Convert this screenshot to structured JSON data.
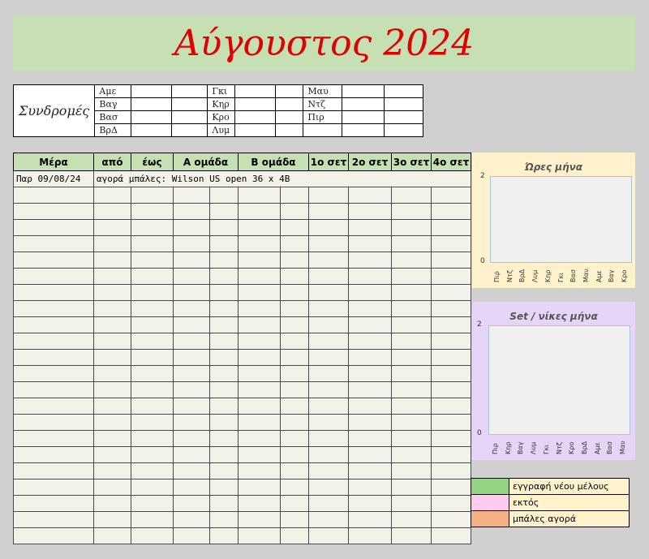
{
  "title": "Αύγουστος 2024",
  "subscriptions": {
    "label": "Συνδρομές",
    "rows": [
      [
        "Αμε",
        "Γκι",
        "Μαυ"
      ],
      [
        "Βαγ",
        "Κηρ",
        "Ντζ"
      ],
      [
        "Βασ",
        "Κρο",
        "Πιρ"
      ],
      [
        "ΒρΔ",
        "Λυμ",
        ""
      ]
    ]
  },
  "schedule": {
    "headers": [
      "Μέρα",
      "από",
      "έως",
      "Α ομάδα",
      "Β ομάδα",
      "1ο σετ",
      "2ο σετ",
      "3ο σετ",
      "4ο σετ"
    ],
    "entry": {
      "day": "Παρ 09/08/24",
      "note": "αγορά μπάλες: Wilson US open 36 x 4B"
    }
  },
  "charts": {
    "hours": {
      "title": "Ώρες μήνα",
      "ymax": "2",
      "ymin": "0",
      "labels": [
        "Πιρ",
        "Ντζ",
        "ΒρΔ",
        "Λυμ",
        "Κηρ",
        "Γκι",
        "Βασ",
        "Μαυ",
        "Αμε",
        "Βαγ",
        "Κρο"
      ]
    },
    "sets": {
      "title": "Set / νίκες μήνα",
      "ymax": "2",
      "ymin": "0",
      "labels": [
        "Πιρ",
        "Κηρ",
        "Βαγ",
        "Λυμ",
        "Γκι",
        "Ντζ",
        "Κρο",
        "ΒρΔ",
        "Αμε",
        "Βασ",
        "Μαυ"
      ]
    }
  },
  "legend": {
    "items": [
      {
        "color": "#92d483",
        "label": "εγγραφή νέου μέλους"
      },
      {
        "color": "#ffccf0",
        "label": "εκτός"
      },
      {
        "color": "#f4b183",
        "label": "μπάλες αγορά"
      }
    ]
  },
  "colors": {
    "title_banner": "#c6e0b4",
    "title_text": "#e00000",
    "hours_chart_bg": "#fff2cc",
    "sets_chart_bg": "#e6d5f7"
  }
}
